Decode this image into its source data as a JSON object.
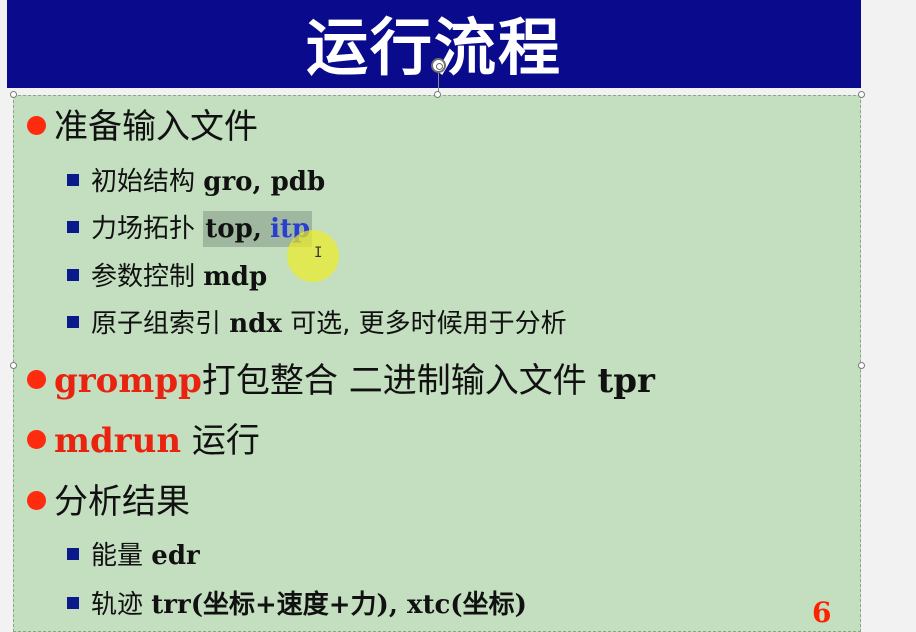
{
  "slide": {
    "title": "运行流程",
    "page_number": "6"
  },
  "bullets": [
    {
      "text": "准备输入文件"
    },
    {
      "text_cn": "初始结构",
      "code": "gro, pdb"
    },
    {
      "text_cn": "力场拓扑",
      "code_a": "top,",
      "code_b": "itp"
    },
    {
      "text_cn": "参数控制",
      "code": "mdp"
    },
    {
      "text_cn": "原子组索引",
      "code": "ndx",
      "text_tail_a": "可选",
      "text_tail_b": ", 更多时候用于分析"
    },
    {
      "code_red": "grompp",
      "text_cn": "打包整合 二进制输入文件",
      "code": "tpr"
    },
    {
      "code_red": "mdrun",
      "text_cn": "运行"
    },
    {
      "text": "分析结果"
    },
    {
      "text_cn": "能量",
      "code": "edr"
    },
    {
      "text_cn": "轨迹",
      "code": "trr(坐标+速度+力), xtc(坐标)"
    }
  ],
  "colors": {
    "title_bar": "#0a0a8c",
    "content_bg": "#c3dfc0",
    "bullet_dot": "#ff2b0f",
    "sub_bullet": "#0a1a8a",
    "red_text": "#e8230f"
  }
}
